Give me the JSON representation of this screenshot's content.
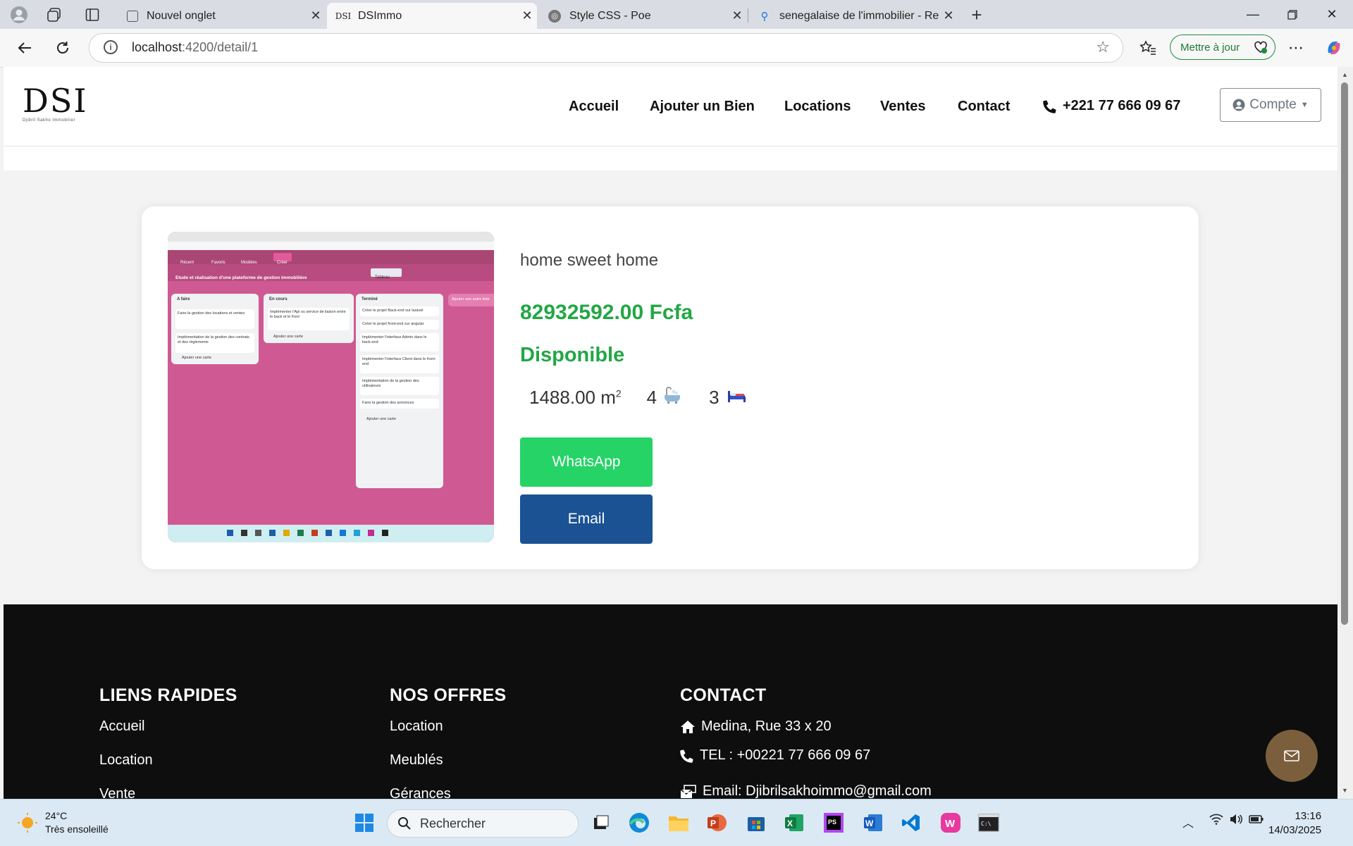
{
  "browser": {
    "tabs": [
      {
        "title": "Nouvel onglet"
      },
      {
        "title": "DSImmo"
      },
      {
        "title": "Style CSS - Poe"
      },
      {
        "title": "senegalaise de l'immobilier - Rech"
      }
    ],
    "address": {
      "host": "localhost",
      "path": ":4200/detail/1"
    },
    "update_label": "Mettre à jour"
  },
  "header": {
    "logo_text": "DSI",
    "logo_sub": "Djibril Sakho Immobilier",
    "nav": [
      "Accueil",
      "Ajouter un Bien",
      "Locations",
      "Ventes",
      "Contact"
    ],
    "phone": "+221 77 666 09 67",
    "account_label": "Compte"
  },
  "property": {
    "name": "home sweet home",
    "price": "82932592.00 Fcfa",
    "status": "Disponible",
    "area": "1488.00 m",
    "area_exp": "2",
    "bathrooms": "4",
    "bedrooms": "3",
    "whatsapp_label": "WhatsApp",
    "email_label": "Email"
  },
  "embedded_screenshot": {
    "board_title": "Etude et réalisation d'une plateforme de gestion immobilière",
    "view_label": "Tableau",
    "create_label": "Créer",
    "menu": [
      "Récent",
      "Favoris",
      "Modèles"
    ],
    "columns": [
      {
        "title": "A faire",
        "cards": [
          "Faire la gestion des locations et ventes",
          "Implémentation de la gestion des contrats et des règlements"
        ]
      },
      {
        "title": "En cours",
        "cards": [
          "Implémenter l'Api ou service de liaison entre le back et le front"
        ]
      },
      {
        "title": "Terminé",
        "cards": [
          "Créer le projet Back-end sur laravel",
          "Créer le projet front-end sur angular",
          "Implémenter l'interface Admin dans le back-end",
          "Implémenter l'interface Client dans le front-end",
          "Implémentation de la gestion des utilisateurs",
          "Faire la gestion des annonces"
        ]
      }
    ],
    "add_card": "Ajouter une carte",
    "add_list": "Ajouter une autre liste"
  },
  "footer": {
    "quick_links": {
      "title": "LIENS RAPIDES",
      "items": [
        "Accueil",
        "Location",
        "Vente"
      ]
    },
    "offers": {
      "title": "NOS OFFRES",
      "items": [
        "Location",
        "Meublés",
        "Gérances"
      ]
    },
    "contact": {
      "title": "CONTACT",
      "address": "Medina, Rue 33 x 20",
      "tel": "TEL : +00221 77 666 09 67",
      "email": "Email: Djibrilsakhoimmo@gmail.com"
    }
  },
  "taskbar": {
    "weather_temp": "24°C",
    "weather_desc": "Très ensoleillé",
    "search_placeholder": "Rechercher",
    "time": "13:16",
    "date": "14/03/2025"
  },
  "colors": {
    "accent_green": "#22a745",
    "whatsapp": "#25d366",
    "email_btn": "#1a5294",
    "footer_bg": "#0e0e0e",
    "fab": "#7b5f3c"
  }
}
